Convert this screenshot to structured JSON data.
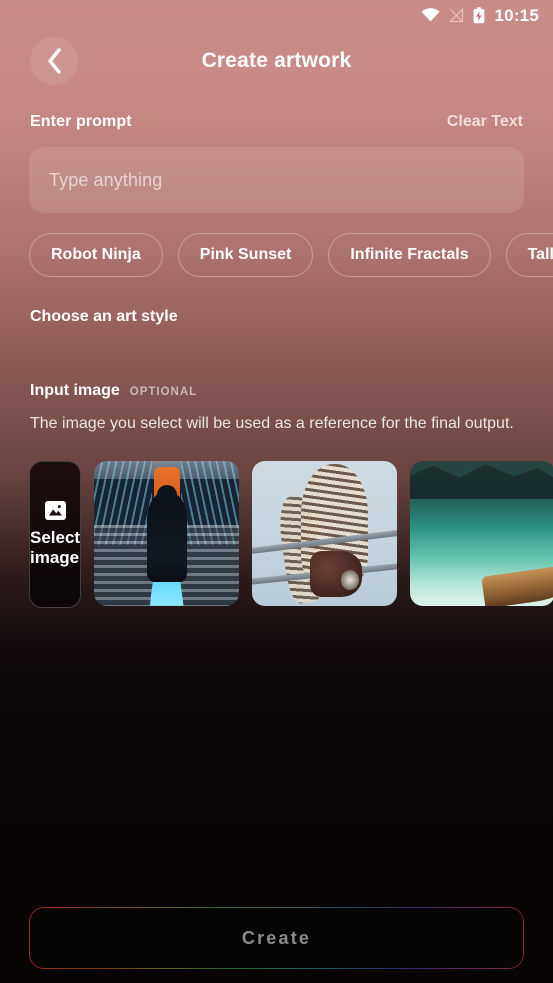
{
  "statusbar": {
    "time": "10:15",
    "icons": [
      "wifi-icon",
      "signal-off-icon",
      "battery-charging-icon"
    ]
  },
  "header": {
    "back_icon": "chevron-left-icon",
    "title": "Create artwork"
  },
  "prompt": {
    "label": "Enter prompt",
    "clear_label": "Clear Text",
    "value": "",
    "placeholder": "Type anything"
  },
  "chips": [
    {
      "label": "Robot Ninja"
    },
    {
      "label": "Pink Sunset"
    },
    {
      "label": "Infinite Fractals"
    },
    {
      "label": "Tall Bird"
    }
  ],
  "art_style": {
    "heading": "Choose an art style"
  },
  "input_image": {
    "title": "Input image",
    "badge": "OPTIONAL",
    "description": "The image you select will be used as a reference for the final output.",
    "select_card": {
      "icon": "picture-icon",
      "label": "Select image"
    },
    "thumbnails": [
      {
        "name": "escalator-night-photo"
      },
      {
        "name": "owl-on-wire-photo"
      },
      {
        "name": "turquoise-lake-boat-photo"
      }
    ]
  },
  "footer": {
    "create_label": "Create",
    "create_enabled": false
  },
  "colors": {
    "background_top": "#c78a85",
    "background_bottom": "#0a0505",
    "text_primary": "#ffffff",
    "text_muted": "#8b8b8b",
    "accent_border": "#f2dedc"
  }
}
